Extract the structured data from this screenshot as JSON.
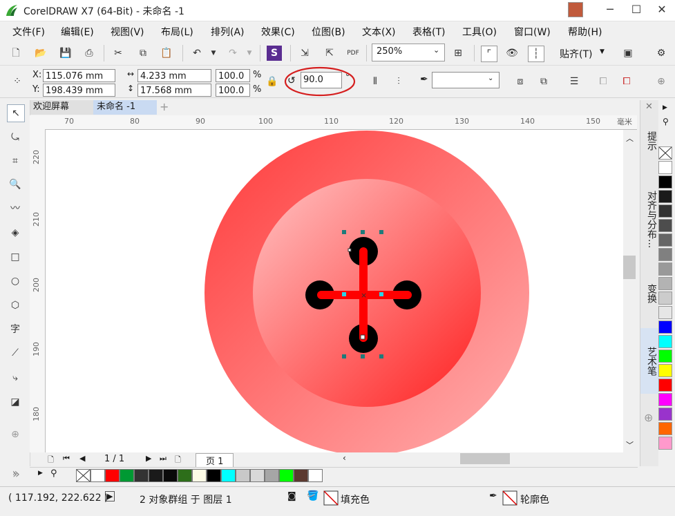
{
  "window": {
    "title": "CorelDRAW X7 (64-Bit) - 未命名 -1",
    "minimize": "─",
    "maximize": "☐",
    "close": "✕"
  },
  "menu": [
    "文件(F)",
    "编辑(E)",
    "视图(V)",
    "布局(L)",
    "排列(A)",
    "效果(C)",
    "位图(B)",
    "文本(X)",
    "表格(T)",
    "工具(O)",
    "窗口(W)",
    "帮助(H)"
  ],
  "toolbar": {
    "zoom": "250%",
    "snap_label": "贴齐(T)"
  },
  "properties": {
    "x": "115.076 mm",
    "y": "198.439 mm",
    "width": "4.233 mm",
    "height": "17.568 mm",
    "scale_w": "100.0",
    "scale_h": "100.0",
    "percent_symbol": "%",
    "x_label": "X:",
    "y_label": "Y:",
    "rotation": "90.0",
    "degree_symbol": "°",
    "outline_width": ""
  },
  "tabs": {
    "welcome": "欢迎屏幕",
    "document": "未命名 -1",
    "add": "+"
  },
  "ruler": {
    "unit": "毫米",
    "h_ticks": [
      "70",
      "80",
      "90",
      "100",
      "110",
      "120",
      "130",
      "140",
      "150"
    ],
    "v_ticks": [
      "220",
      "210",
      "200",
      "190",
      "180"
    ]
  },
  "page_nav": {
    "page_count": "1 / 1",
    "page_tab": "页 1"
  },
  "dockers": {
    "hints": "提示",
    "align": "对齐与分布...",
    "transform": "变换",
    "artistic": "艺术笔"
  },
  "palette_v": [
    "#ffffff",
    "#000000",
    "#1a1a1a",
    "#333333",
    "#4d4d4d",
    "#666666",
    "#808080",
    "#999999",
    "#b3b3b3",
    "#cccccc",
    "#e6e6e6",
    "#0000ff",
    "#00ffff",
    "#00ff00",
    "#ffff00",
    "#ff0000",
    "#ff00ff",
    "#9933cc",
    "#ff6600",
    "#ff99cc"
  ],
  "palette_h": [
    "#ffffff",
    "#ff0000",
    "#009933",
    "#333333",
    "#1a1a1a",
    "#0a0a0a",
    "#2d6e1a",
    "#fdfbe6",
    "#000000",
    "#00ffff",
    "#c8c8c8",
    "#d9d9d9",
    "#a6a6a6",
    "#00ff00",
    "#5c3a30",
    "#ffffff"
  ],
  "status": {
    "cursor": "( 117.192, 222.622 )",
    "selection": "2 对象群组 于 图层 1",
    "fill_label": "填充色",
    "outline_label": "轮廓色"
  }
}
